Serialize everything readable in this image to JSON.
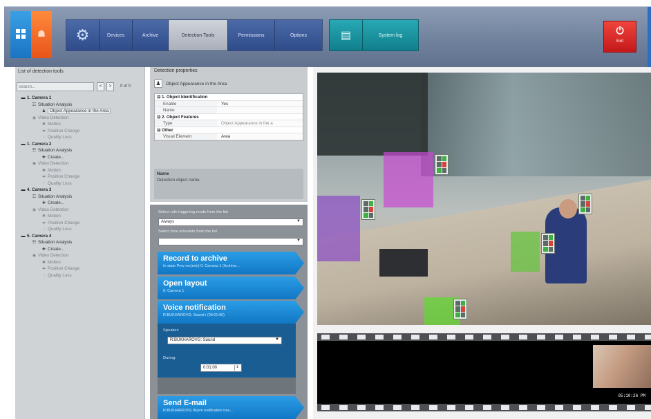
{
  "toolbar": {
    "tabs": [
      {
        "label": "Devices",
        "active": false
      },
      {
        "label": "Archive",
        "active": false
      },
      {
        "label": "Detection Tools",
        "active": true
      },
      {
        "label": "Permissions",
        "active": false
      },
      {
        "label": "Options",
        "active": false
      }
    ],
    "system_log_label": "System log",
    "exit_label": "Exit",
    "colors": {
      "accent_blue": "#2f4b8a",
      "accent_teal": "#117f8c",
      "exit_red": "#c4181a"
    }
  },
  "tree_panel": {
    "title": "List of detection tools",
    "search_placeholder": "Search...",
    "count": "0 of 0",
    "nodes": [
      {
        "level": 0,
        "icon": "camera-icon",
        "label": "1. Camera 1",
        "dim": false,
        "selected": false
      },
      {
        "level": 1,
        "icon": "analysis-icon",
        "label": "Situation Analysis",
        "dim": false,
        "selected": false
      },
      {
        "level": 2,
        "icon": "object-icon",
        "label": "Object Appearance in the Area",
        "dim": false,
        "selected": true
      },
      {
        "level": 1,
        "icon": "video-detection-icon",
        "label": "Video Detection",
        "dim": true,
        "selected": false
      },
      {
        "level": 2,
        "icon": "motion-icon",
        "label": "Motion",
        "dim": true,
        "selected": false
      },
      {
        "level": 2,
        "icon": "position-icon",
        "label": "Position Change",
        "dim": true,
        "selected": false
      },
      {
        "level": 2,
        "icon": "quality-icon",
        "label": "Quality Loss",
        "dim": true,
        "selected": false
      },
      {
        "level": 0,
        "icon": "camera-icon",
        "label": "1. Camera 2",
        "dim": false,
        "selected": false
      },
      {
        "level": 1,
        "icon": "analysis-icon",
        "label": "Situation Analysis",
        "dim": false,
        "selected": false
      },
      {
        "level": 2,
        "icon": "create-icon",
        "label": "Create...",
        "dim": false,
        "selected": false
      },
      {
        "level": 1,
        "icon": "video-detection-icon",
        "label": "Video Detection",
        "dim": true,
        "selected": false
      },
      {
        "level": 2,
        "icon": "motion-icon",
        "label": "Motion",
        "dim": true,
        "selected": false
      },
      {
        "level": 2,
        "icon": "position-icon",
        "label": "Position Change",
        "dim": true,
        "selected": false
      },
      {
        "level": 2,
        "icon": "quality-icon",
        "label": "Quality Loss",
        "dim": true,
        "selected": false
      },
      {
        "level": 0,
        "icon": "camera-icon",
        "label": "4. Camera 3",
        "dim": false,
        "selected": false
      },
      {
        "level": 1,
        "icon": "analysis-icon",
        "label": "Situation Analysis",
        "dim": false,
        "selected": false
      },
      {
        "level": 2,
        "icon": "create-icon",
        "label": "Create...",
        "dim": false,
        "selected": false
      },
      {
        "level": 1,
        "icon": "video-detection-icon",
        "label": "Video Detection",
        "dim": true,
        "selected": false
      },
      {
        "level": 2,
        "icon": "motion-icon",
        "label": "Motion",
        "dim": true,
        "selected": false
      },
      {
        "level": 2,
        "icon": "position-icon",
        "label": "Position Change",
        "dim": true,
        "selected": false
      },
      {
        "level": 2,
        "icon": "quality-icon",
        "label": "Quality Loss",
        "dim": true,
        "selected": false
      },
      {
        "level": 0,
        "icon": "camera-icon",
        "label": "5. Camera 4",
        "dim": false,
        "selected": false
      },
      {
        "level": 1,
        "icon": "analysis-icon",
        "label": "Situation Analysis",
        "dim": false,
        "selected": false
      },
      {
        "level": 2,
        "icon": "create-icon",
        "label": "Create...",
        "dim": false,
        "selected": false
      },
      {
        "level": 1,
        "icon": "video-detection-icon",
        "label": "Video Detection",
        "dim": true,
        "selected": false
      },
      {
        "level": 2,
        "icon": "motion-icon",
        "label": "Motion",
        "dim": true,
        "selected": false
      },
      {
        "level": 2,
        "icon": "position-icon",
        "label": "Position Change",
        "dim": true,
        "selected": false
      },
      {
        "level": 2,
        "icon": "quality-icon",
        "label": "Quality Loss",
        "dim": true,
        "selected": false
      }
    ]
  },
  "properties": {
    "title": "Detection properties",
    "object_name": "Object Appearance in the Area",
    "rows": [
      {
        "type": "section",
        "label": "1. Object Identification"
      },
      {
        "type": "prop",
        "key": "Enable",
        "value": "Yes",
        "dim": false
      },
      {
        "type": "prop",
        "key": "Name",
        "value": "",
        "dim": false
      },
      {
        "type": "section",
        "label": "2. Object Features"
      },
      {
        "type": "prop",
        "key": "Type",
        "value": "Object Appearance in the a",
        "dim": true
      },
      {
        "type": "section",
        "label": "Other"
      },
      {
        "type": "prop",
        "key": "Visual Element",
        "value": "Area",
        "dim": false
      }
    ],
    "desc_name": "Name",
    "desc_text": "Detection object name"
  },
  "actions": {
    "trigger_label": "Select rule triggering mode from the list",
    "trigger_value": "Always",
    "schedule_label": "Select time schedule from the list",
    "schedule_value": "",
    "items": [
      {
        "title": "Record to archive",
        "subtitle": "In state Prev rec(min) 0: Camera 1 (Archive..."
      },
      {
        "title": "Open layout",
        "subtitle": "0: Camera 1"
      },
      {
        "title": "Voice notification",
        "subtitle": "R:BUKHAROVG: Sound i (00:01:00)"
      },
      {
        "title": "Send E-mail",
        "subtitle": "R:BUKHAROVG: Alarm notification Ires..."
      }
    ],
    "voice": {
      "speaker_label": "Speaker:",
      "speaker_value": "R:BUKHAROVG: Sound",
      "during_label": "During:",
      "during_value": "0:01:00"
    }
  },
  "video": {
    "timestamp": "05:10:26 PM"
  }
}
